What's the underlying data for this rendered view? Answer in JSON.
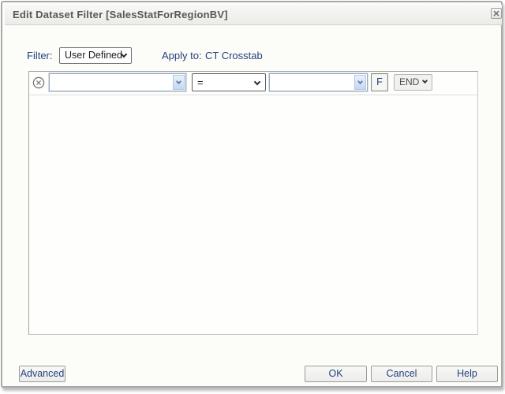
{
  "window": {
    "title": "Edit Dataset Filter [SalesStatForRegionBV]"
  },
  "toolbar": {
    "filter_label": "Filter:",
    "filter_selected": "User Defined",
    "apply_to_label": "Apply to:",
    "apply_to_target": "CT Crosstab"
  },
  "filter_row": {
    "field_selected": "",
    "operator_selected": "=",
    "value_selected": "",
    "formula_button": "F",
    "conjunction_selected": "END"
  },
  "footer": {
    "advanced": "Advanced",
    "ok": "OK",
    "cancel": "Cancel",
    "help": "Help"
  },
  "icons": {
    "close": "close-icon",
    "delete_row": "delete-row-circle-x-icon",
    "dropdown": "chevron-down-icon"
  },
  "colors": {
    "label_navy": "#24427c",
    "title_gray": "#585858",
    "combo_border_blue": "#95a9c6",
    "combo_arrow_fill": "#c5d8f2",
    "panel_border_dark": "#999997",
    "panel_border_light": "#c9c9c7",
    "button_face": "#f3f3f1"
  }
}
